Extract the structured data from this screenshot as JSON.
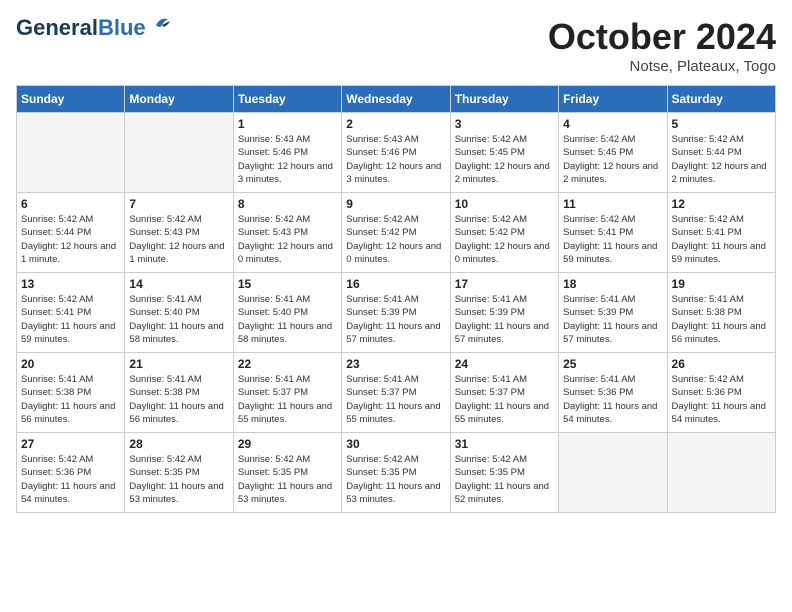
{
  "header": {
    "logo_line1": "General",
    "logo_line2": "Blue",
    "month": "October 2024",
    "location": "Notse, Plateaux, Togo"
  },
  "days_of_week": [
    "Sunday",
    "Monday",
    "Tuesday",
    "Wednesday",
    "Thursday",
    "Friday",
    "Saturday"
  ],
  "weeks": [
    [
      {
        "day": "",
        "info": ""
      },
      {
        "day": "",
        "info": ""
      },
      {
        "day": "1",
        "info": "Sunrise: 5:43 AM\nSunset: 5:46 PM\nDaylight: 12 hours and 3 minutes."
      },
      {
        "day": "2",
        "info": "Sunrise: 5:43 AM\nSunset: 5:46 PM\nDaylight: 12 hours and 3 minutes."
      },
      {
        "day": "3",
        "info": "Sunrise: 5:42 AM\nSunset: 5:45 PM\nDaylight: 12 hours and 2 minutes."
      },
      {
        "day": "4",
        "info": "Sunrise: 5:42 AM\nSunset: 5:45 PM\nDaylight: 12 hours and 2 minutes."
      },
      {
        "day": "5",
        "info": "Sunrise: 5:42 AM\nSunset: 5:44 PM\nDaylight: 12 hours and 2 minutes."
      }
    ],
    [
      {
        "day": "6",
        "info": "Sunrise: 5:42 AM\nSunset: 5:44 PM\nDaylight: 12 hours and 1 minute."
      },
      {
        "day": "7",
        "info": "Sunrise: 5:42 AM\nSunset: 5:43 PM\nDaylight: 12 hours and 1 minute."
      },
      {
        "day": "8",
        "info": "Sunrise: 5:42 AM\nSunset: 5:43 PM\nDaylight: 12 hours and 0 minutes."
      },
      {
        "day": "9",
        "info": "Sunrise: 5:42 AM\nSunset: 5:42 PM\nDaylight: 12 hours and 0 minutes."
      },
      {
        "day": "10",
        "info": "Sunrise: 5:42 AM\nSunset: 5:42 PM\nDaylight: 12 hours and 0 minutes."
      },
      {
        "day": "11",
        "info": "Sunrise: 5:42 AM\nSunset: 5:41 PM\nDaylight: 11 hours and 59 minutes."
      },
      {
        "day": "12",
        "info": "Sunrise: 5:42 AM\nSunset: 5:41 PM\nDaylight: 11 hours and 59 minutes."
      }
    ],
    [
      {
        "day": "13",
        "info": "Sunrise: 5:42 AM\nSunset: 5:41 PM\nDaylight: 11 hours and 59 minutes."
      },
      {
        "day": "14",
        "info": "Sunrise: 5:41 AM\nSunset: 5:40 PM\nDaylight: 11 hours and 58 minutes."
      },
      {
        "day": "15",
        "info": "Sunrise: 5:41 AM\nSunset: 5:40 PM\nDaylight: 11 hours and 58 minutes."
      },
      {
        "day": "16",
        "info": "Sunrise: 5:41 AM\nSunset: 5:39 PM\nDaylight: 11 hours and 57 minutes."
      },
      {
        "day": "17",
        "info": "Sunrise: 5:41 AM\nSunset: 5:39 PM\nDaylight: 11 hours and 57 minutes."
      },
      {
        "day": "18",
        "info": "Sunrise: 5:41 AM\nSunset: 5:39 PM\nDaylight: 11 hours and 57 minutes."
      },
      {
        "day": "19",
        "info": "Sunrise: 5:41 AM\nSunset: 5:38 PM\nDaylight: 11 hours and 56 minutes."
      }
    ],
    [
      {
        "day": "20",
        "info": "Sunrise: 5:41 AM\nSunset: 5:38 PM\nDaylight: 11 hours and 56 minutes."
      },
      {
        "day": "21",
        "info": "Sunrise: 5:41 AM\nSunset: 5:38 PM\nDaylight: 11 hours and 56 minutes."
      },
      {
        "day": "22",
        "info": "Sunrise: 5:41 AM\nSunset: 5:37 PM\nDaylight: 11 hours and 55 minutes."
      },
      {
        "day": "23",
        "info": "Sunrise: 5:41 AM\nSunset: 5:37 PM\nDaylight: 11 hours and 55 minutes."
      },
      {
        "day": "24",
        "info": "Sunrise: 5:41 AM\nSunset: 5:37 PM\nDaylight: 11 hours and 55 minutes."
      },
      {
        "day": "25",
        "info": "Sunrise: 5:41 AM\nSunset: 5:36 PM\nDaylight: 11 hours and 54 minutes."
      },
      {
        "day": "26",
        "info": "Sunrise: 5:42 AM\nSunset: 5:36 PM\nDaylight: 11 hours and 54 minutes."
      }
    ],
    [
      {
        "day": "27",
        "info": "Sunrise: 5:42 AM\nSunset: 5:36 PM\nDaylight: 11 hours and 54 minutes."
      },
      {
        "day": "28",
        "info": "Sunrise: 5:42 AM\nSunset: 5:35 PM\nDaylight: 11 hours and 53 minutes."
      },
      {
        "day": "29",
        "info": "Sunrise: 5:42 AM\nSunset: 5:35 PM\nDaylight: 11 hours and 53 minutes."
      },
      {
        "day": "30",
        "info": "Sunrise: 5:42 AM\nSunset: 5:35 PM\nDaylight: 11 hours and 53 minutes."
      },
      {
        "day": "31",
        "info": "Sunrise: 5:42 AM\nSunset: 5:35 PM\nDaylight: 11 hours and 52 minutes."
      },
      {
        "day": "",
        "info": ""
      },
      {
        "day": "",
        "info": ""
      }
    ]
  ]
}
